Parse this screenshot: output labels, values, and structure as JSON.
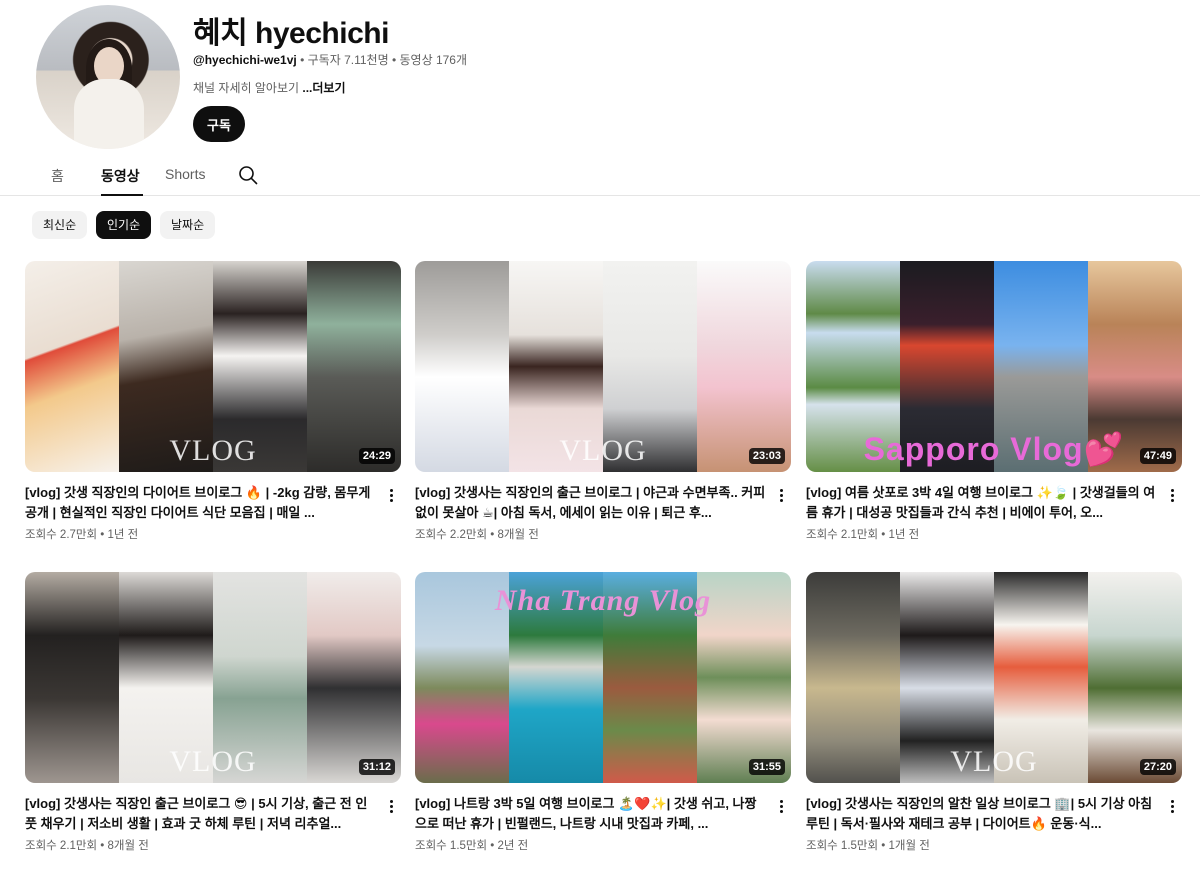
{
  "channel": {
    "name": "혜치 hyechichi",
    "handle": "@hyechichi-we1vj",
    "stats": "• 구독자 7.11천명 • 동영상 176개",
    "description": "채널 자세히 알아보기",
    "more": "...더보기",
    "subscribe_label": "구독"
  },
  "tabs": [
    {
      "label": "홈"
    },
    {
      "label": "동영상"
    },
    {
      "label": "Shorts"
    }
  ],
  "chips": [
    {
      "label": "최신순"
    },
    {
      "label": "인기순"
    },
    {
      "label": "날짜순"
    }
  ],
  "videos": [
    {
      "title": "[vlog] 갓생 직장인의 다이어트 브이로그 🔥 |  -2kg 감량, 몸무게 공개 | 현실적인 직장인 다이어트 식단 모음집 | 매일 ...",
      "meta": "조회수 2.7만회 • 1년 전",
      "duration": "24:29",
      "overlay": "VLOG"
    },
    {
      "title": "[vlog] 갓생사는 직장인의 출근 브이로그 | 야근과 수면부족.. 커피없이 못살아 ☕| 아침 독서, 에세이 읽는 이유 | 퇴근 후...",
      "meta": "조회수 2.2만회 • 8개월 전",
      "duration": "23:03",
      "overlay": "VLOG"
    },
    {
      "title": "[vlog] 여름 삿포로 3박 4일 여행 브이로그 ✨🍃 | 갓생걸들의 여름 휴가 | 대성공 맛집들과 간식 추천 | 비에이 투어, 오...",
      "meta": "조회수 2.1만회 • 1년 전",
      "duration": "47:49",
      "overlay": "Sapporo Vlog💕"
    },
    {
      "title": "[vlog] 갓생사는 직장인 출근 브이로그 😎 | 5시 기상, 출근 전 인풋 채우기 | 저소비 생활 | 효과 굿 하체 루틴 | 저녁 리추얼...",
      "meta": "조회수 2.1만회 • 8개월 전",
      "duration": "31:12",
      "overlay": "VLOG"
    },
    {
      "title": "[vlog] 나트랑 3박 5일 여행 브이로그 🏝️❤️✨| 갓생 쉬고, 나짱으로 떠난 휴가 | 빈펄랜드, 나트랑 시내 맛집과 카페, ...",
      "meta": "조회수 1.5만회 • 2년 전",
      "duration": "31:55",
      "overlay": "Nha Trang Vlog"
    },
    {
      "title": "[vlog] 갓생사는 직장인의 알찬 일상 브이로그 🏢| 5시 기상 아침 루틴 | 독서·필사와 재테크 공부 | 다이어트🔥 운동·식...",
      "meta": "조회수 1.5만회 • 1개월 전",
      "duration": "27:20",
      "overlay": "VLOG"
    }
  ],
  "colors": {
    "text": "#0f0f0f",
    "secondary": "#606060",
    "chip_bg": "#f2f2f2",
    "accent_pink": "#e86ad8"
  }
}
